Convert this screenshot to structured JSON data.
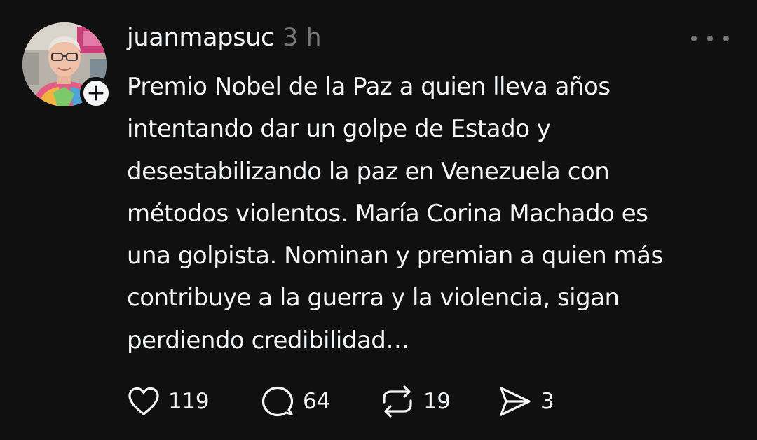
{
  "post": {
    "username": "juanmapsuc",
    "timestamp": "3 h",
    "text": "Premio Nobel de la Paz a quien lleva años\nintentando dar un golpe de Estado y\ndesestabilizando la paz en Venezuela con\nmétodos violentos. María Corina Machado es\nuna golpista. Nominan y premian a quien más\ncontribuye a la guerra y la violencia, sigan\nperdiendo credibilidad…",
    "avatar_icon": "user-avatar-photo",
    "follow_icon": "plus-icon",
    "more_icon": "more-options-icon"
  },
  "actions": {
    "likes": {
      "icon": "heart-icon",
      "count": "119"
    },
    "comments": {
      "icon": "comment-icon",
      "count": "64"
    },
    "reposts": {
      "icon": "repost-icon",
      "count": "19"
    },
    "shares": {
      "icon": "share-icon",
      "count": "3"
    }
  },
  "colors": {
    "background": "#101010",
    "primary_text": "#f3f5f7",
    "secondary_text": "#777777"
  }
}
